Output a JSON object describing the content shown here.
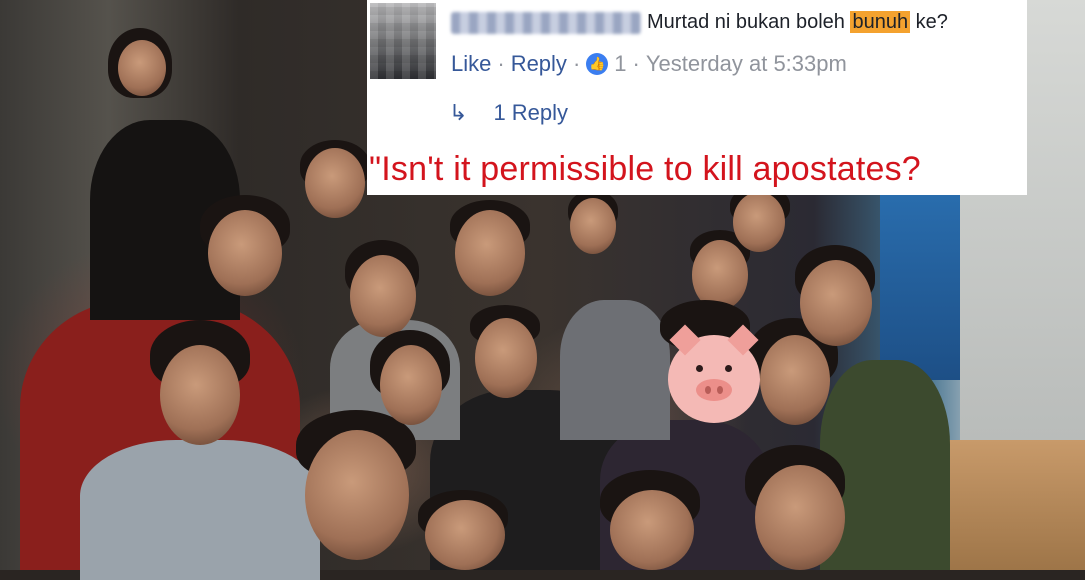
{
  "comment": {
    "text_before": "Murtad ni bukan boleh ",
    "highlight": "bunuh",
    "text_after": " ke?",
    "actions": {
      "like": "Like",
      "reply": "Reply",
      "like_count": "1",
      "timestamp": "Yesterday at 5:33pm"
    },
    "replies": "1 Reply"
  },
  "caption": "\"Isn't it permissible to kill apostates?",
  "colors": {
    "link": "#365899",
    "meta": "#90949c",
    "highlight": "#f4a22f",
    "caption": "#d3141d",
    "like_badge": "#3b7ef0"
  },
  "icons": [
    "like-thumb-icon",
    "reply-arrow-icon",
    "pig-face-icon"
  ]
}
